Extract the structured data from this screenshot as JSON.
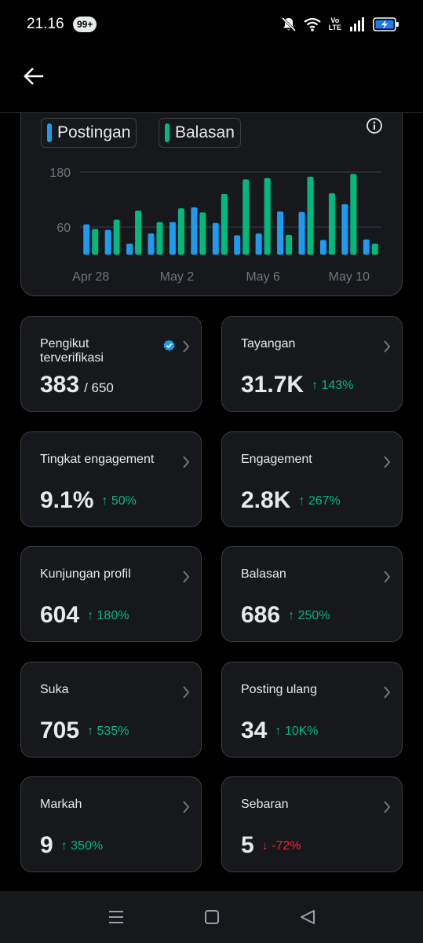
{
  "status_bar": {
    "time": "21.16",
    "badge": "99+",
    "volte": [
      "Vo",
      "LTE"
    ]
  },
  "chart_data": {
    "type": "bar",
    "legend": [
      {
        "name": "Postingan",
        "color": "#1d9bf0"
      },
      {
        "name": "Balasan",
        "color": "#00ba7c"
      }
    ],
    "y_ticks": [
      60,
      180
    ],
    "x_tick_labels": [
      "Apr 28",
      "May 2",
      "May 6",
      "May 10"
    ],
    "ylim": [
      0,
      180
    ],
    "grid": true,
    "series": [
      {
        "name": "Postingan",
        "color": "#1d9bf0",
        "values": [
          66,
          54,
          24,
          46,
          71,
          103,
          69,
          42,
          46,
          94,
          93,
          32,
          110,
          33
        ]
      },
      {
        "name": "Balasan",
        "color": "#00ba7c",
        "values": [
          56,
          76,
          96,
          71,
          101,
          92,
          132,
          164,
          167,
          43,
          170,
          134,
          176,
          24
        ]
      }
    ]
  },
  "stats": [
    {
      "title": "Pengikut terverifikasi",
      "value": "383",
      "sub": "/ 650",
      "change": "",
      "direction": "none",
      "verified": true
    },
    {
      "title": "Tayangan",
      "value": "31.7K",
      "change": "143%",
      "direction": "up"
    },
    {
      "title": "Tingkat engagement",
      "value": "9.1%",
      "change": "50%",
      "direction": "up"
    },
    {
      "title": "Engagement",
      "value": "2.8K",
      "change": "267%",
      "direction": "up"
    },
    {
      "title": "Kunjungan profil",
      "value": "604",
      "change": "180%",
      "direction": "up"
    },
    {
      "title": "Balasan",
      "value": "686",
      "change": "250%",
      "direction": "up"
    },
    {
      "title": "Suka",
      "value": "705",
      "change": "535%",
      "direction": "up"
    },
    {
      "title": "Posting ulang",
      "value": "34",
      "change": "10K%",
      "direction": "up"
    },
    {
      "title": "Markah",
      "value": "9",
      "change": "350%",
      "direction": "up"
    },
    {
      "title": "Sebaran",
      "value": "5",
      "change": "-72%",
      "direction": "down"
    }
  ]
}
